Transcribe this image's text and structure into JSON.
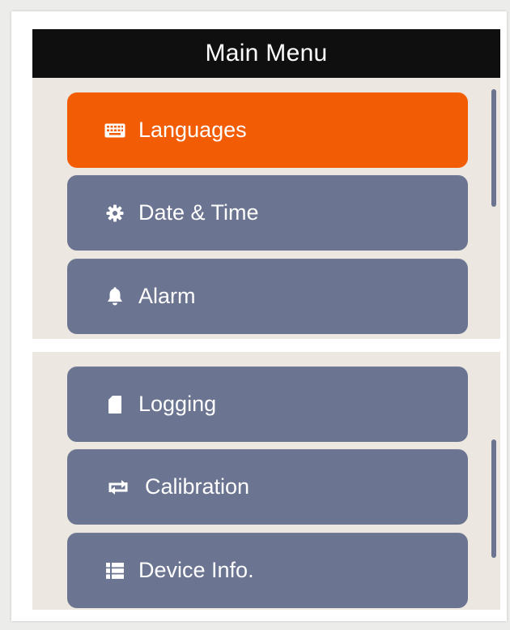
{
  "header": {
    "title": "Main Menu"
  },
  "menu": {
    "items": [
      {
        "id": "languages",
        "label": "Languages",
        "icon": "keyboard-icon",
        "active": true
      },
      {
        "id": "date-time",
        "label": "Date & Time",
        "icon": "gear-icon",
        "active": false
      },
      {
        "id": "alarm",
        "label": "Alarm",
        "icon": "bell-icon",
        "active": false
      },
      {
        "id": "logging",
        "label": "Logging",
        "icon": "sd-card-icon",
        "active": false
      },
      {
        "id": "calibration",
        "label": "Calibration",
        "icon": "repeat-arrows-icon",
        "active": false
      },
      {
        "id": "device-info",
        "label": "Device Info.",
        "icon": "list-icon",
        "active": false
      }
    ]
  },
  "colors": {
    "active": "#f25c05",
    "inactive": "#6b7490",
    "title_bar": "#0f0f10",
    "panel": "#ece8e1"
  }
}
